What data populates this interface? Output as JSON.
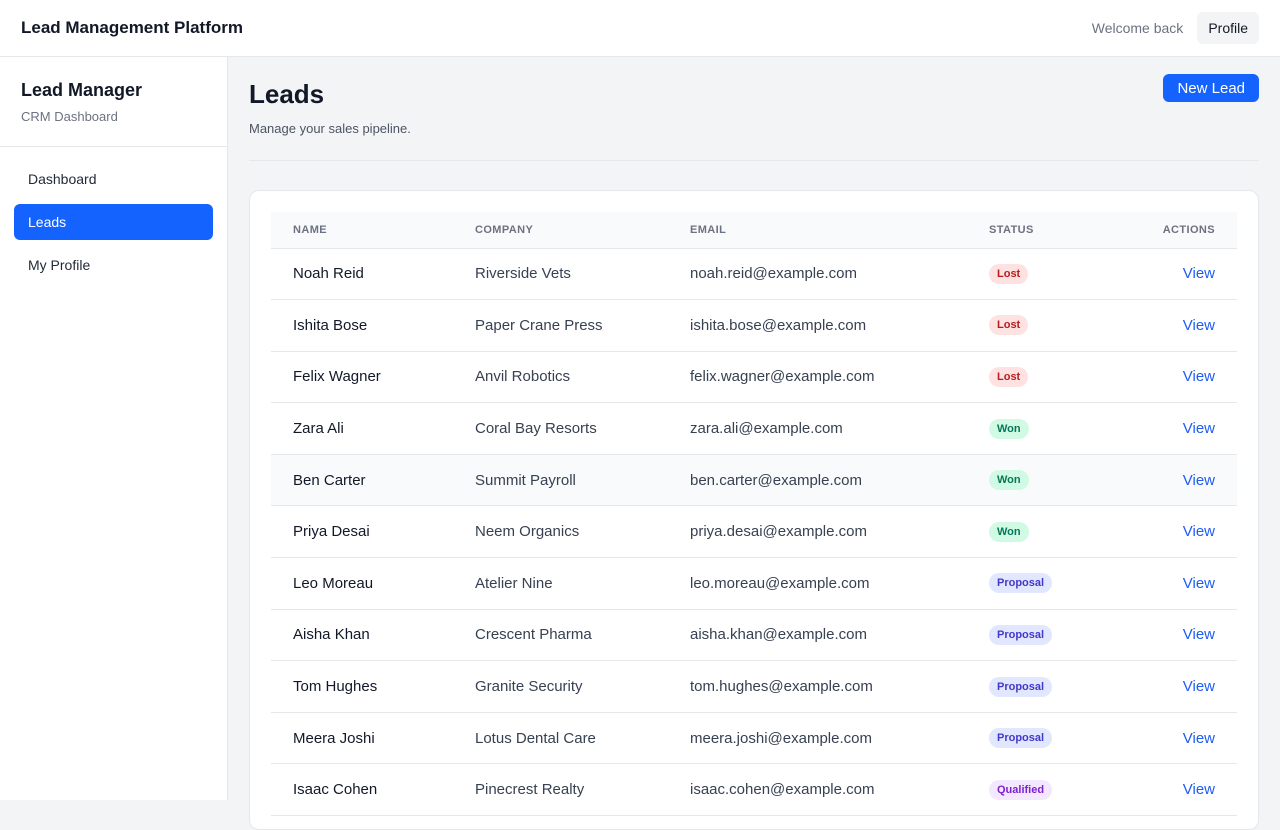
{
  "topbar": {
    "title": "Lead Management Platform",
    "welcome": "Welcome back",
    "profile_label": "Profile"
  },
  "sidebar": {
    "brand_name": "Lead Manager",
    "brand_sub": "CRM Dashboard",
    "items": [
      {
        "label": "Dashboard",
        "active": false
      },
      {
        "label": "Leads",
        "active": true
      },
      {
        "label": "My Profile",
        "active": false
      }
    ]
  },
  "page": {
    "title": "Leads",
    "subtitle": "Manage your sales pipeline.",
    "new_lead_label": "New Lead"
  },
  "table": {
    "headers": {
      "name": "NAME",
      "company": "COMPANY",
      "email": "EMAIL",
      "status": "STATUS",
      "actions": "ACTIONS"
    },
    "rows": [
      {
        "name": "Noah Reid",
        "company": "Riverside Vets",
        "email": "noah.reid@example.com",
        "status": "Lost",
        "action": "View"
      },
      {
        "name": "Ishita Bose",
        "company": "Paper Crane Press",
        "email": "ishita.bose@example.com",
        "status": "Lost",
        "action": "View"
      },
      {
        "name": "Felix Wagner",
        "company": "Anvil Robotics",
        "email": "felix.wagner@example.com",
        "status": "Lost",
        "action": "View"
      },
      {
        "name": "Zara Ali",
        "company": "Coral Bay Resorts",
        "email": "zara.ali@example.com",
        "status": "Won",
        "action": "View"
      },
      {
        "name": "Ben Carter",
        "company": "Summit Payroll",
        "email": "ben.carter@example.com",
        "status": "Won",
        "action": "View"
      },
      {
        "name": "Priya Desai",
        "company": "Neem Organics",
        "email": "priya.desai@example.com",
        "status": "Won",
        "action": "View"
      },
      {
        "name": "Leo Moreau",
        "company": "Atelier Nine",
        "email": "leo.moreau@example.com",
        "status": "Proposal",
        "action": "View"
      },
      {
        "name": "Aisha Khan",
        "company": "Crescent Pharma",
        "email": "aisha.khan@example.com",
        "status": "Proposal",
        "action": "View"
      },
      {
        "name": "Tom Hughes",
        "company": "Granite Security",
        "email": "tom.hughes@example.com",
        "status": "Proposal",
        "action": "View"
      },
      {
        "name": "Meera Joshi",
        "company": "Lotus Dental Care",
        "email": "meera.joshi@example.com",
        "status": "Proposal",
        "action": "View"
      },
      {
        "name": "Isaac Cohen",
        "company": "Pinecrest Realty",
        "email": "isaac.cohen@example.com",
        "status": "Qualified",
        "action": "View"
      }
    ]
  },
  "colors": {
    "accent": "#1463ff",
    "lost_bg": "#fee2e2",
    "lost_fg": "#b91c1c",
    "won_bg": "#d1fae5",
    "won_fg": "#047857",
    "proposal_bg": "#e0e7ff",
    "proposal_fg": "#4338ca",
    "qualified_bg": "#f3e8ff",
    "qualified_fg": "#7e22ce"
  }
}
